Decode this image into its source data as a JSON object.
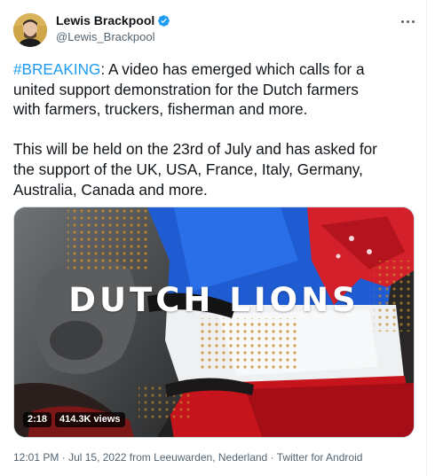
{
  "tweet": {
    "author": {
      "display_name": "Lewis Brackpool",
      "handle": "@Lewis_Brackpool",
      "verified_icon": "verified-badge-icon",
      "verified_color": "#1d9bf0"
    },
    "more_icon": "more-options-icon",
    "hashtag": "#BREAKING",
    "text_line1_rest": ": A video has emerged which calls for a\nunited support demonstration for the Dutch farmers\nwith farmers, truckers, fisherman and more.\n\nThis will be held on the 23rd of July and has asked for\nthe support of the UK, USA, France, Italy, Germany,\nAustralia, Canada and more.",
    "media": {
      "overlay_title": "DUTCH LIONS",
      "duration": "2:18",
      "views": "414.3K views"
    },
    "meta": {
      "time": "12:01 PM",
      "dot1": "·",
      "date": "Jul 15, 2022",
      "from_prefix": "from",
      "location": "Leeuwarden, Nederland",
      "dot2": "·",
      "source": "Twitter for Android"
    },
    "colors": {
      "link": "#1d9bf0",
      "secondary_text": "#536471",
      "primary_text": "#0f1419"
    }
  }
}
